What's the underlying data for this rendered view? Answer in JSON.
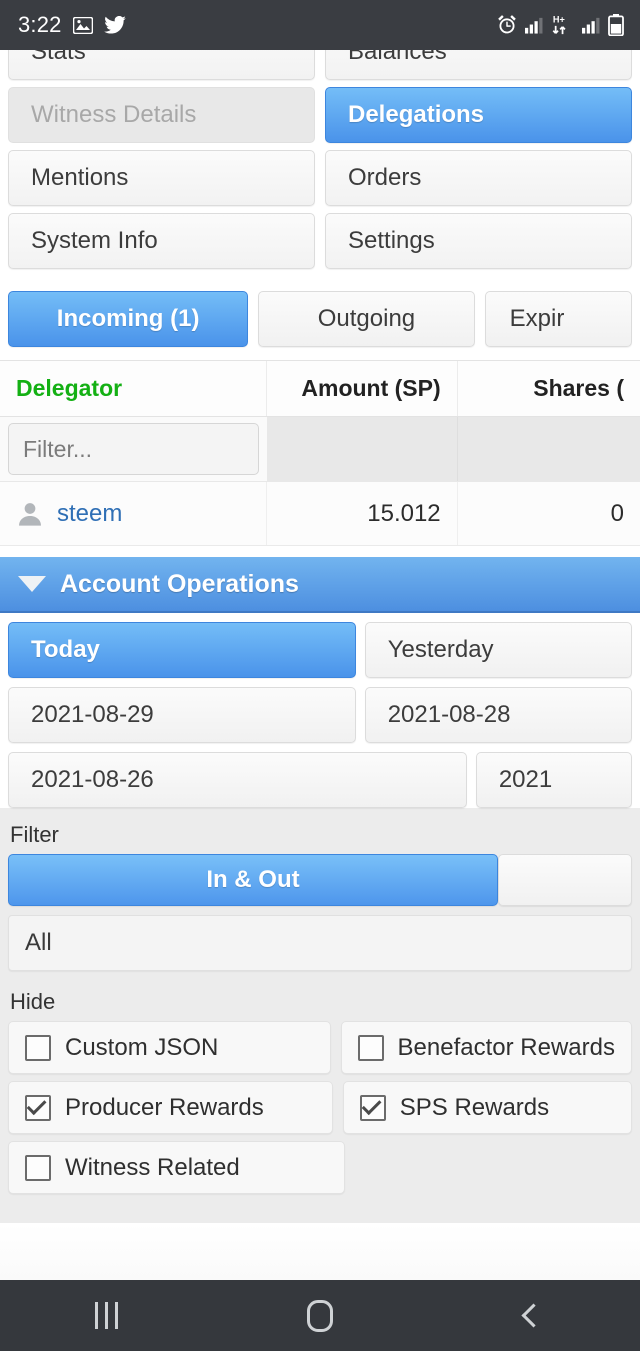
{
  "statusbar": {
    "time": "3:22",
    "left_icons": [
      "gallery-icon",
      "twitter-icon"
    ],
    "right_icons": [
      "alarm-icon",
      "signal-icon",
      "hplus-data-icon",
      "signal-2-icon",
      "battery-icon"
    ],
    "data_label": "H+",
    "background": "#3a3d42"
  },
  "nav_buttons": {
    "row1": [
      {
        "label": "Stats",
        "state": "normal"
      },
      {
        "label": "Balances",
        "state": "normal"
      }
    ],
    "row2": [
      {
        "label": "Witness Details",
        "state": "disabled"
      },
      {
        "label": "Delegations",
        "state": "active"
      }
    ],
    "row3": [
      {
        "label": "Mentions",
        "state": "normal"
      },
      {
        "label": "Orders",
        "state": "normal"
      }
    ],
    "row4": [
      {
        "label": "System Info",
        "state": "normal"
      },
      {
        "label": "Settings",
        "state": "normal"
      }
    ]
  },
  "delegation_tabs": [
    {
      "label": "Incoming (1)",
      "state": "active"
    },
    {
      "label": "Outgoing",
      "state": "normal"
    },
    {
      "label": "Expir",
      "state": "normal",
      "clipped": true
    }
  ],
  "delegations_table": {
    "columns": [
      "Delegator",
      "Amount (SP)",
      "Shares ("
    ],
    "filter_placeholder": "Filter...",
    "rows": [
      {
        "avatar": "person-icon",
        "delegator": "steem",
        "amount": "15.012",
        "shares": "0"
      }
    ]
  },
  "account_operations": {
    "header": "Account Operations",
    "collapse_icon": "triangle-down-icon",
    "date_tabs": [
      {
        "label": "Today",
        "state": "active"
      },
      {
        "label": "Yesterday",
        "state": "normal"
      },
      {
        "label": "2021-08-29",
        "state": "normal"
      },
      {
        "label": "2021-08-28",
        "state": "normal"
      },
      {
        "label": "2021-08-26",
        "state": "normal"
      },
      {
        "label": "2021",
        "state": "normal",
        "clipped": true
      }
    ]
  },
  "filter_section": {
    "label": "Filter",
    "segments": [
      {
        "label": "In & Out",
        "state": "active"
      },
      {
        "label": "",
        "state": "normal"
      }
    ],
    "select_value": "All"
  },
  "hide_section": {
    "label": "Hide",
    "options": [
      {
        "label": "Custom JSON",
        "checked": false
      },
      {
        "label": "Benefactor Rewards",
        "checked": false
      },
      {
        "label": "Producer Rewards",
        "checked": true
      },
      {
        "label": "SPS Rewards",
        "checked": true
      },
      {
        "label": "Witness Related",
        "checked": false
      }
    ]
  },
  "navbar": {
    "recents_label": "recents-icon",
    "home_label": "home-icon",
    "back_label": "back-icon"
  },
  "colors": {
    "accent_blue": "#4a93ea",
    "accent_blue_light": "#74bdf7",
    "header_green": "#14b014",
    "link_blue": "#2f6fb5",
    "statusbar_dark": "#3a3d42",
    "panel_gray": "#ececec"
  }
}
